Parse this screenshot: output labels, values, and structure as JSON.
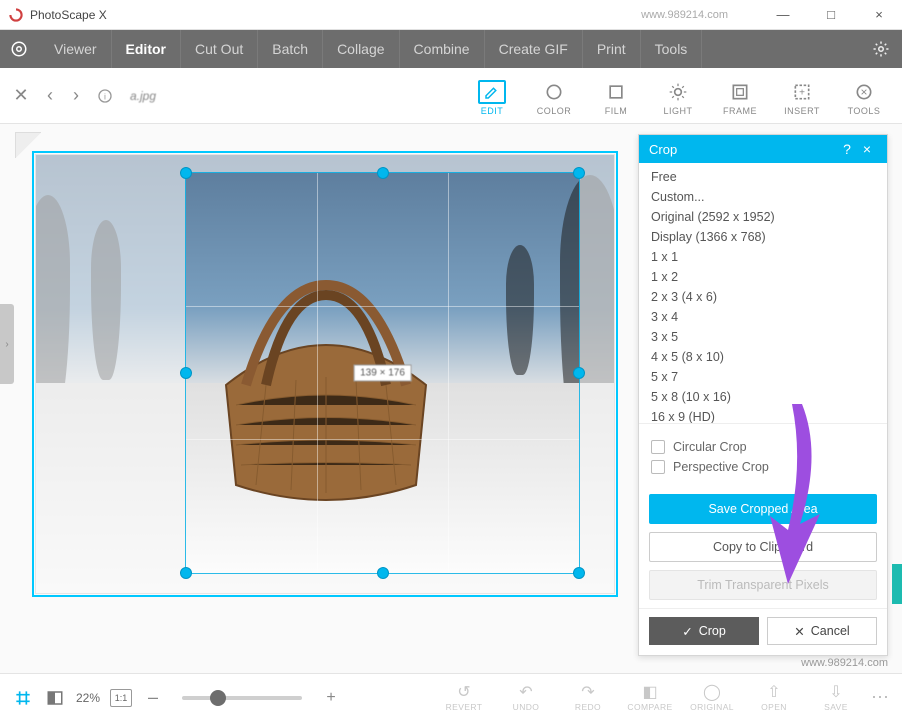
{
  "app": {
    "title": "PhotoScape X"
  },
  "window_controls": {
    "min": "—",
    "max": "□",
    "close": "×"
  },
  "tabs": {
    "items": [
      "Viewer",
      "Editor",
      "Cut Out",
      "Batch",
      "Collage",
      "Combine",
      "Create GIF",
      "Print",
      "Tools"
    ],
    "active_index": 1
  },
  "subbar": {
    "filename": "a.jpg"
  },
  "tool_tiles": [
    {
      "label": "EDIT",
      "icon": "edit"
    },
    {
      "label": "COLOR",
      "icon": "color"
    },
    {
      "label": "FILM",
      "icon": "film"
    },
    {
      "label": "LIGHT",
      "icon": "light"
    },
    {
      "label": "FRAME",
      "icon": "frame"
    },
    {
      "label": "INSERT",
      "icon": "insert"
    },
    {
      "label": "TOOLS",
      "icon": "tools"
    }
  ],
  "crop_panel": {
    "title": "Crop",
    "ratios": [
      "Free",
      "Custom...",
      "Original (2592 x 1952)",
      "Display (1366 x 768)",
      "1 x 1",
      "1 x 2",
      "2 x 3 (4 x 6)",
      "3 x 4",
      "3 x 5",
      "4 x 5 (8 x 10)",
      "5 x 7",
      "5 x 8 (10 x 16)",
      "16 x 9 (HD)"
    ],
    "circular": "Circular Crop",
    "perspective": "Perspective Crop",
    "save_btn": "Save Cropped Area",
    "copy_btn": "Copy to Clipboard",
    "trim_btn": "Trim Transparent Pixels",
    "ok_btn": "Crop",
    "cancel_btn": "Cancel"
  },
  "crop_overlay": {
    "dims_label": "139 × 176"
  },
  "bottombar": {
    "zoom_pct": "22%",
    "fit_label": "1:1",
    "minus": "–",
    "plus": "+",
    "actions": [
      {
        "label": "REVERT"
      },
      {
        "label": "UNDO"
      },
      {
        "label": "REDO"
      },
      {
        "label": "COMPARE"
      },
      {
        "label": "ORIGINAL"
      },
      {
        "label": "OPEN"
      },
      {
        "label": "SAVE"
      }
    ]
  },
  "watermark": "www.989214.com",
  "colors": {
    "accent": "#00b7ee",
    "arrow": "#9d4ee0"
  }
}
